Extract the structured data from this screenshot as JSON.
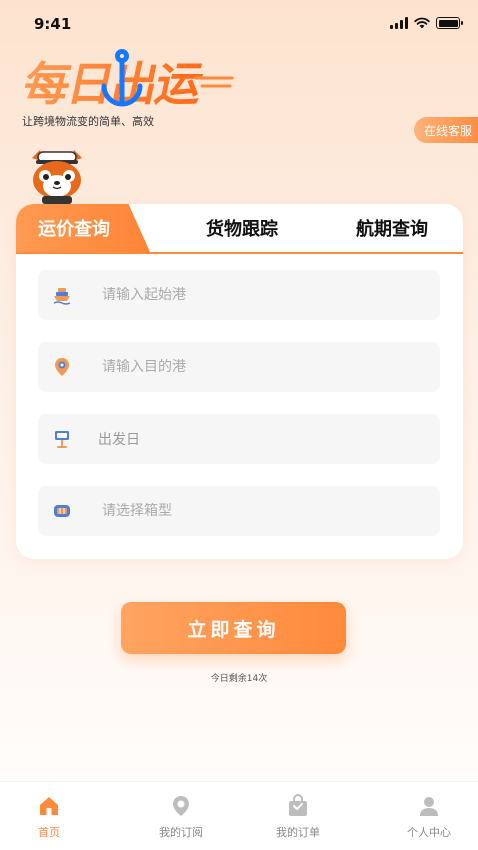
{
  "status_bar": {
    "time": "9:41"
  },
  "brand": {
    "logo_text": "每日出运",
    "slogan": "让跨境物流变的简单、高效",
    "accent": "#ff8a3c",
    "logo_gradient": [
      "#ff9a52",
      "#ff6a1a"
    ]
  },
  "header": {
    "online_service": "在线客服"
  },
  "search_card": {
    "tabs": [
      {
        "label": "运价查询",
        "active": true
      },
      {
        "label": "货物跟踪",
        "active": false
      },
      {
        "label": "航期查询",
        "active": false
      }
    ],
    "fields": {
      "origin_port": {
        "placeholder": "请输入起始港",
        "icon": "ship-icon"
      },
      "destination_port": {
        "placeholder": "请输入目的港",
        "icon": "location-pin-icon"
      },
      "departure_date": {
        "label": "出发日",
        "icon": "calendar-sign-icon"
      },
      "container_type": {
        "placeholder": "请选择箱型",
        "icon": "container-icon"
      }
    }
  },
  "query": {
    "button_label": "立即查询",
    "remaining_text": "今日剩余14次"
  },
  "tabbar": [
    {
      "label": "首页",
      "icon": "home-icon",
      "active": true
    },
    {
      "label": "我的订阅",
      "icon": "subscription-pin-icon",
      "active": false
    },
    {
      "label": "我的订单",
      "icon": "shopping-bag-icon",
      "active": false
    },
    {
      "label": "个人中心",
      "icon": "user-icon",
      "active": false
    }
  ]
}
